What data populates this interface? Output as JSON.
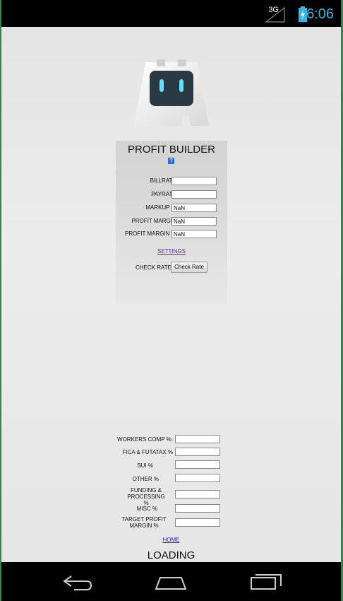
{
  "status_bar": {
    "network": "3G",
    "time": "6:06",
    "icons": [
      "signal-icon",
      "battery-charging-icon"
    ]
  },
  "app": {
    "title": "PROFIT BUILDER",
    "help_glyph": "?",
    "fields": [
      {
        "label": "BILLRATE:",
        "value": ""
      },
      {
        "label": "PAYRATE:",
        "value": ""
      },
      {
        "label": "MARKUP %:",
        "value": "NaN"
      },
      {
        "label": "PROFIT MARGIN:",
        "value": "NaN"
      },
      {
        "label": "PROFIT MARGIN %:",
        "value": "NaN"
      }
    ],
    "settings_link": "SETTINGS",
    "check_rate_label": "CHECK RATE",
    "check_rate_button": "Check Rate"
  },
  "settings": {
    "fields": [
      {
        "label": "WORKERS COMP %:",
        "value": ""
      },
      {
        "label": "FICA & FUTATAX %",
        "value": ""
      },
      {
        "label": "SUI %",
        "value": ""
      },
      {
        "label": "OTHER %",
        "value": ""
      },
      {
        "label": "FUNDING & PROCESSING %",
        "value": ""
      },
      {
        "label": "MISC %",
        "value": ""
      },
      {
        "label": "TARGET PROFIT MARGIN %",
        "value": ""
      }
    ],
    "home_link": "HOME",
    "loading_text": "LOADING"
  },
  "nav_bar": {
    "buttons": [
      "back-icon",
      "home-icon",
      "recent-apps-icon"
    ]
  },
  "colors": {
    "status_accent": "#33b5e5",
    "frame": "#2a8a48",
    "link_visited": "#5a2a8a",
    "link": "#1a1aee"
  }
}
